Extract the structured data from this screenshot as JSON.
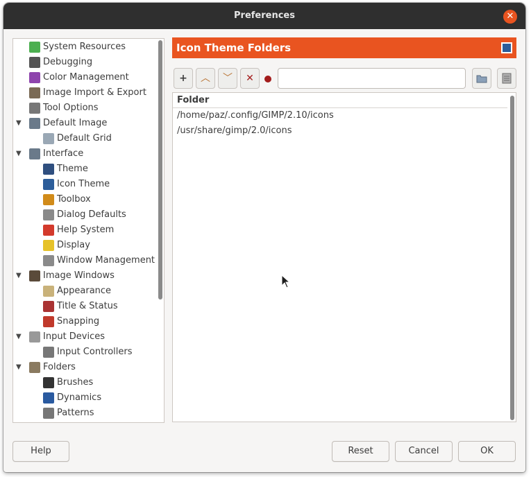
{
  "window": {
    "title": "Preferences",
    "close_symbol": "✕"
  },
  "tree": {
    "items": [
      {
        "label": "System Resources",
        "icon": "memory-chip-icon",
        "expander": "",
        "level": 0
      },
      {
        "label": "Debugging",
        "icon": "bug-icon",
        "expander": "",
        "level": 0
      },
      {
        "label": "Color Management",
        "icon": "color-management-icon",
        "expander": "",
        "level": 0
      },
      {
        "label": "Image Import & Export",
        "icon": "image-import-export-icon",
        "expander": "",
        "level": 0
      },
      {
        "label": "Tool Options",
        "icon": "tool-options-icon",
        "expander": "",
        "level": 0
      },
      {
        "label": "Default Image",
        "icon": "default-image-icon",
        "expander": "▼",
        "level": 0
      },
      {
        "label": "Default Grid",
        "icon": "grid-icon",
        "expander": "",
        "level": 1
      },
      {
        "label": "Interface",
        "icon": "interface-icon",
        "expander": "▼",
        "level": 0
      },
      {
        "label": "Theme",
        "icon": "theme-icon",
        "expander": "",
        "level": 1
      },
      {
        "label": "Icon Theme",
        "icon": "icon-theme-icon",
        "expander": "",
        "level": 1
      },
      {
        "label": "Toolbox",
        "icon": "toolbox-icon",
        "expander": "",
        "level": 1
      },
      {
        "label": "Dialog Defaults",
        "icon": "dialog-defaults-icon",
        "expander": "",
        "level": 1
      },
      {
        "label": "Help System",
        "icon": "lifebuoy-icon",
        "expander": "",
        "level": 1
      },
      {
        "label": "Display",
        "icon": "display-icon",
        "expander": "",
        "level": 1
      },
      {
        "label": "Window Management",
        "icon": "window-management-icon",
        "expander": "",
        "level": 1
      },
      {
        "label": "Image Windows",
        "icon": "image-windows-icon",
        "expander": "▼",
        "level": 0
      },
      {
        "label": "Appearance",
        "icon": "appearance-icon",
        "expander": "",
        "level": 1
      },
      {
        "label": "Title & Status",
        "icon": "title-status-icon",
        "expander": "",
        "level": 1
      },
      {
        "label": "Snapping",
        "icon": "snapping-icon",
        "expander": "",
        "level": 1
      },
      {
        "label": "Input Devices",
        "icon": "input-devices-icon",
        "expander": "▼",
        "level": 0
      },
      {
        "label": "Input Controllers",
        "icon": "input-controllers-icon",
        "expander": "",
        "level": 1
      },
      {
        "label": "Folders",
        "icon": "folders-icon",
        "expander": "▼",
        "level": 0
      },
      {
        "label": "Brushes",
        "icon": "brush-icon",
        "expander": "",
        "level": 1
      },
      {
        "label": "Dynamics",
        "icon": "dynamics-icon",
        "expander": "",
        "level": 1
      },
      {
        "label": "Patterns",
        "icon": "patterns-icon",
        "expander": "",
        "level": 1
      }
    ]
  },
  "section": {
    "title": "Icon Theme Folders",
    "icon": "icon-theme-icon"
  },
  "toolbar": {
    "new_symbol": "+",
    "up_symbol": "︿",
    "down_symbol": "﹀",
    "delete_symbol": "✕",
    "path_value": "",
    "path_placeholder": ""
  },
  "folders": {
    "column_header": "Folder",
    "rows": [
      "/home/paz/.config/GIMP/2.10/icons",
      "/usr/share/gimp/2.0/icons"
    ]
  },
  "footer": {
    "help": "Help",
    "reset": "Reset",
    "cancel": "Cancel",
    "ok": "OK"
  },
  "colors": {
    "accent": "#e95420",
    "titlebar": "#2f2f2f",
    "window_bg": "#f6f5f4"
  }
}
